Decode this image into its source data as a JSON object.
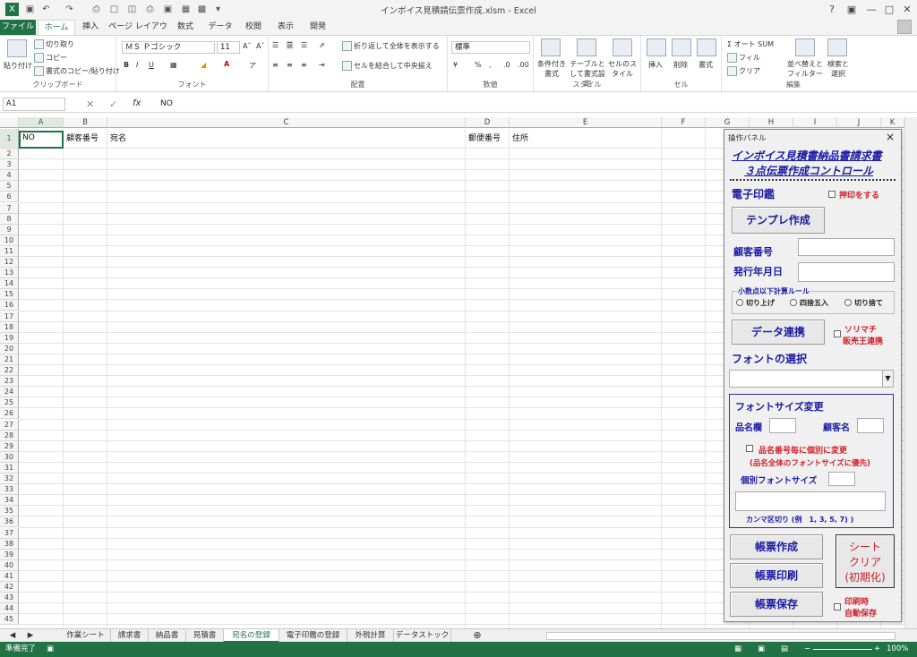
{
  "window": {
    "title": "インボイス見積請伝票作成.xlsm - Excel"
  },
  "ribbon_tabs": [
    "ファイル",
    "ホーム",
    "挿入",
    "ページ レイアウト",
    "数式",
    "データ",
    "校閲",
    "表示",
    "開発"
  ],
  "ribbon": {
    "clipboard": {
      "label": "クリップボード",
      "paste": "貼り付け",
      "cut": "切り取り",
      "copy": "コピー",
      "format_painter": "書式のコピー/貼り付け"
    },
    "font": {
      "label": "フォント",
      "font_name": "ＭＳ Ｐゴシック",
      "font_size": "11",
      "bold": "B",
      "italic": "I",
      "underline": "U"
    },
    "alignment": {
      "label": "配置",
      "wrap": "折り返して全体を表示する",
      "merge": "セルを結合して中央揃え"
    },
    "number": {
      "label": "数値",
      "format": "標準",
      "percent": "%",
      "comma": ","
    },
    "styles": {
      "label": "スタイル",
      "conditional": "条件付き書式",
      "table": "テーブルとして書式設定",
      "cell": "セルのスタイル"
    },
    "cells": {
      "label": "セル",
      "insert": "挿入",
      "delete": "削除",
      "format": "書式"
    },
    "editing": {
      "label": "編集",
      "autosum": "オート SUM",
      "fill": "フィル",
      "clear": "クリア",
      "sort": "並べ替えとフィルター",
      "find": "検索と選択"
    }
  },
  "formula_bar": {
    "name_box": "A1",
    "fx": "fx",
    "content": "NO"
  },
  "columns": [
    "A",
    "B",
    "C",
    "D",
    "E",
    "F",
    "G",
    "H",
    "I",
    "J",
    "K"
  ],
  "row_count": 45,
  "cells": {
    "A1": "NO",
    "B1": "顧客番号",
    "C1": "宛名",
    "D1": "郵便番号",
    "E1": "住所"
  },
  "sheets": [
    "作業シート",
    "請求書",
    "納品書",
    "見積書",
    "宛名の登録",
    "電子印鑑の登録",
    "外税計算",
    "データストック"
  ],
  "active_sheet": "宛名の登録",
  "status": {
    "ready": "準備完了",
    "zoom": "100%"
  },
  "panel": {
    "title": "操作パネル",
    "close": "×",
    "heading1": "インボイス見積書納品書請求書",
    "heading2": "３点伝票作成コントロール",
    "stamp_label": "電子印鑑",
    "stamp_check": "押印をする",
    "template_btn": "テンプレ作成",
    "customer_no": "顧客番号",
    "issue_date": "発行年月日",
    "rounding_title": "小数点以下計算ルール",
    "round_up": "切り上げ",
    "round_half": "四捨五入",
    "round_down": "切り捨て",
    "data_link_btn": "データ連携",
    "sorimachi_1": "ソリマチ",
    "sorimachi_2": "販売王連携",
    "font_select": "フォントの選択",
    "font_size_title": "フォントサイズ変更",
    "item_name": "品名欄",
    "customer_name": "顧客名",
    "individual_check": "品名番号毎に個別に変更",
    "individual_note": "(品名全体のフォントサイズに優先)",
    "individual_size": "個別フォントサイズ",
    "comma_note": "カンマ区切り (例　1, 3, 5, 7) )",
    "make_btn": "帳票作成",
    "print_btn": "帳票印刷",
    "save_btn": "帳票保存",
    "clear_btn_1": "シート",
    "clear_btn_2": "クリア",
    "clear_btn_3": "(初期化)",
    "autosave_1": "印刷時",
    "autosave_2": "自動保存"
  }
}
